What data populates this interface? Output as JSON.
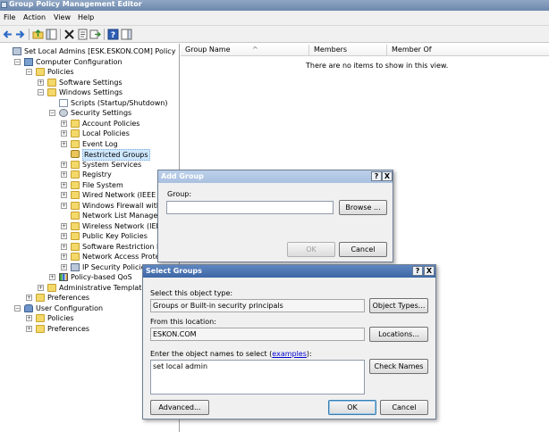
{
  "window": {
    "title": "Group Policy Management Editor"
  },
  "menu": [
    "File",
    "Action",
    "View",
    "Help"
  ],
  "toolbar": {
    "icons": [
      "back-arrow-icon",
      "forward-arrow-icon",
      "up-folder-icon",
      "show-hide-tree-icon",
      "delete-icon",
      "properties-icon",
      "export-list-icon",
      "help-icon",
      "action-pane-icon"
    ]
  },
  "tree": {
    "items": [
      {
        "label": "Set Local Admins [ESK.ESKON.COM] Policy",
        "icon": "policy-icon",
        "indent": 0,
        "exp": ""
      },
      {
        "label": "Computer Configuration",
        "icon": "computer-icon",
        "indent": 1,
        "exp": "−"
      },
      {
        "label": "Policies",
        "icon": "folder-icon",
        "indent": 2,
        "exp": "−"
      },
      {
        "label": "Software Settings",
        "icon": "folder-icon",
        "indent": 3,
        "exp": "+"
      },
      {
        "label": "Windows Settings",
        "icon": "folder-icon",
        "indent": 3,
        "exp": "−"
      },
      {
        "label": "Scripts (Startup/Shutdown)",
        "icon": "document-icon",
        "indent": 4,
        "exp": ""
      },
      {
        "label": "Security Settings",
        "icon": "gear-icon",
        "indent": 4,
        "exp": "−"
      },
      {
        "label": "Account Policies",
        "icon": "folder-icon",
        "indent": 5,
        "exp": "+"
      },
      {
        "label": "Local Policies",
        "icon": "folder-icon",
        "indent": 5,
        "exp": "+"
      },
      {
        "label": "Event Log",
        "icon": "folder-icon",
        "indent": 5,
        "exp": "+"
      },
      {
        "label": "Restricted Groups",
        "icon": "lock-folder-icon",
        "indent": 5,
        "exp": "",
        "selected": true
      },
      {
        "label": "System Services",
        "icon": "folder-icon",
        "indent": 5,
        "exp": "+"
      },
      {
        "label": "Registry",
        "icon": "folder-icon",
        "indent": 5,
        "exp": "+"
      },
      {
        "label": "File System",
        "icon": "folder-icon",
        "indent": 5,
        "exp": "+"
      },
      {
        "label": "Wired Network (IEEE 802.3",
        "icon": "folder-icon",
        "indent": 5,
        "exp": "+"
      },
      {
        "label": "Windows Firewall with Adva",
        "icon": "folder-icon",
        "indent": 5,
        "exp": "+"
      },
      {
        "label": "Network List Manager Polic",
        "icon": "folder-icon",
        "indent": 5,
        "exp": ""
      },
      {
        "label": "Wireless Network (IEEE 802.",
        "icon": "folder-icon",
        "indent": 5,
        "exp": "+"
      },
      {
        "label": "Public Key Policies",
        "icon": "folder-icon",
        "indent": 5,
        "exp": "+"
      },
      {
        "label": "Software Restriction Policie",
        "icon": "folder-icon",
        "indent": 5,
        "exp": "+"
      },
      {
        "label": "Network Access Protection",
        "icon": "folder-icon",
        "indent": 5,
        "exp": "+"
      },
      {
        "label": "IP Security Policies on Acti",
        "icon": "policy-icon",
        "indent": 5,
        "exp": "+"
      },
      {
        "label": "Policy-based QoS",
        "icon": "chart-icon",
        "indent": 4,
        "exp": "+"
      },
      {
        "label": "Administrative Templates: Pol",
        "icon": "folder-icon",
        "indent": 3,
        "exp": "+"
      },
      {
        "label": "Preferences",
        "icon": "folder-icon",
        "indent": 2,
        "exp": "+"
      },
      {
        "label": "User Configuration",
        "icon": "user-icon",
        "indent": 1,
        "exp": "−"
      },
      {
        "label": "Policies",
        "icon": "folder-icon",
        "indent": 2,
        "exp": "+"
      },
      {
        "label": "Preferences",
        "icon": "folder-icon",
        "indent": 2,
        "exp": "+"
      }
    ]
  },
  "list": {
    "columns": [
      "Group Name",
      "Members",
      "Member Of"
    ],
    "sort_indicator": "^",
    "empty_message": "There are no items to show in this view."
  },
  "add_group": {
    "title": "Add Group",
    "help": "?",
    "close": "X",
    "group_label": "Group:",
    "group_value": "",
    "browse": "Browse ...",
    "ok": "OK",
    "cancel": "Cancel"
  },
  "select_groups": {
    "title": "Select Groups",
    "help": "?",
    "close": "X",
    "type_label": "Select this object type:",
    "type_value": "Groups or Built-in security principals",
    "object_types": "Object Types...",
    "location_label": "From this location:",
    "location_value": "ESKON.COM",
    "locations": "Locations...",
    "names_label_pre": "Enter the object names to select (",
    "names_label_link": "examples",
    "names_label_post": "):",
    "names_value": "set local admin",
    "check_names": "Check Names",
    "advanced": "Advanced...",
    "ok": "OK",
    "cancel": "Cancel"
  }
}
